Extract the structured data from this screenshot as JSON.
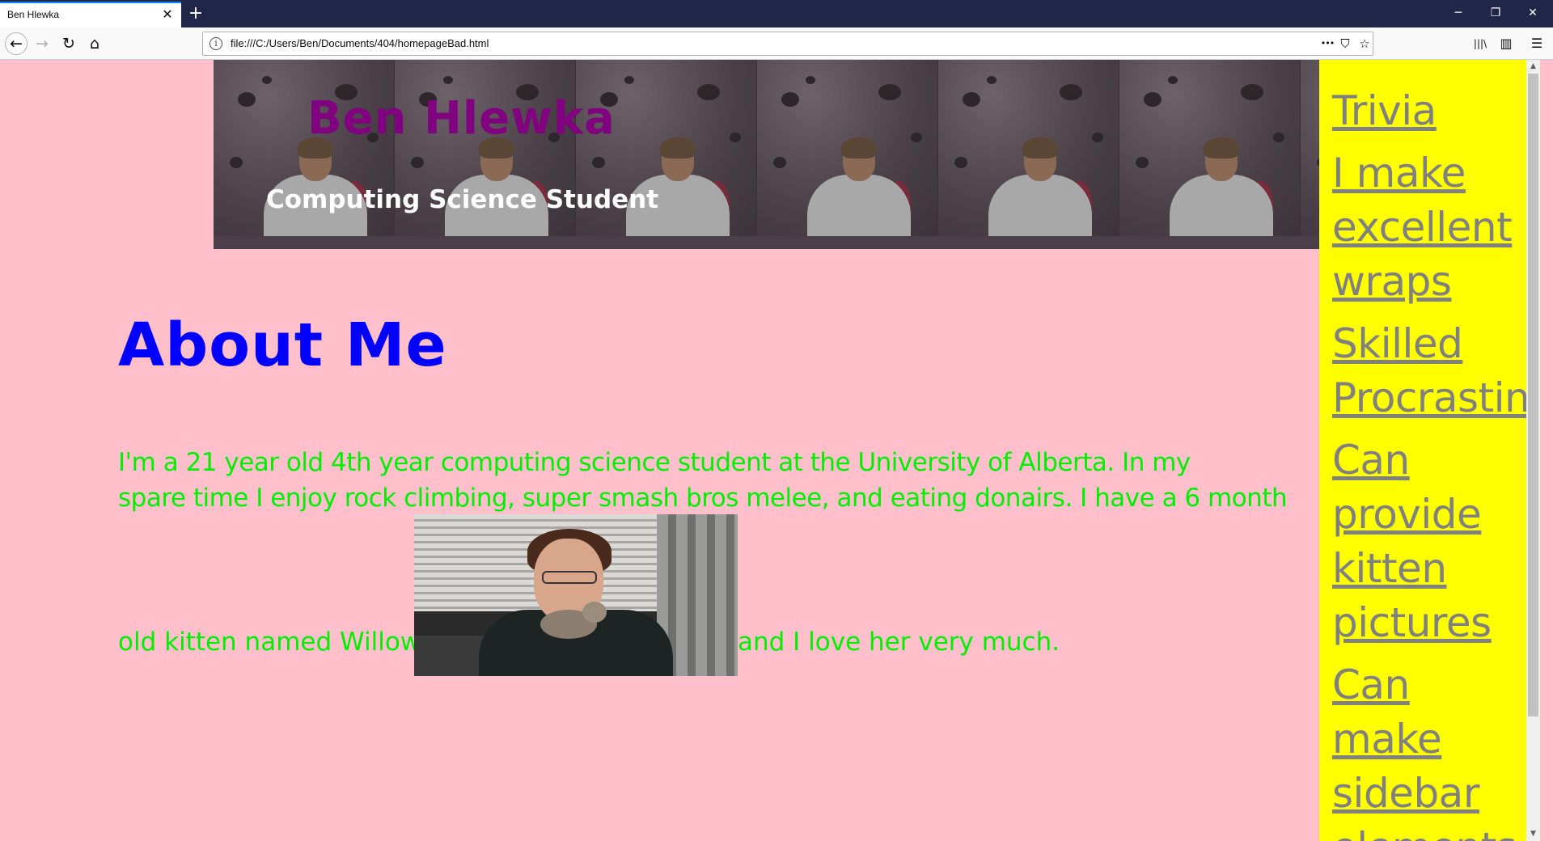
{
  "browser": {
    "tab_title": "Ben Hlewka",
    "tab_close": "✕",
    "new_tab": "+",
    "url": "file:///C:/Users/Ben/Documents/404/homepageBad.html",
    "icons": {
      "back": "←",
      "forward": "→",
      "reload": "↻",
      "home": "⌂",
      "info": "i",
      "more": "•••",
      "pocket": "⛉",
      "bookmark": "☆",
      "library": "|||\\",
      "sidebar": "▥",
      "menu": "☰",
      "minimize": "─",
      "restore": "❐",
      "close": "✕"
    }
  },
  "banner": {
    "title": "Ben Hlewka",
    "subtitle": "Computing Science Student",
    "title_color": "#800080",
    "subtitle_color": "#ffffff"
  },
  "about": {
    "heading": "About Me",
    "line1": "I'm a 21 year old 4th year computing science student at the University of Alberta. In my",
    "line2": "spare time I enjoy rock climbing, super smash bros melee, and eating donairs. I have a 6 month",
    "line3_pre": "old kitten named Willow",
    "line3_post": "and I love her very much.",
    "heading_color": "#0000ff",
    "text_color": "#00ee00"
  },
  "sidebar": {
    "background": "#ffff00",
    "link_color": "#808080",
    "items": [
      {
        "label": "Trivia"
      },
      {
        "label": "I make excellent wraps"
      },
      {
        "label": "Skilled Procrastinator"
      },
      {
        "label": "Can provide kitten pictures"
      },
      {
        "label": "Can make sidebar elements"
      }
    ]
  },
  "page": {
    "background": "#ffc0cb"
  }
}
